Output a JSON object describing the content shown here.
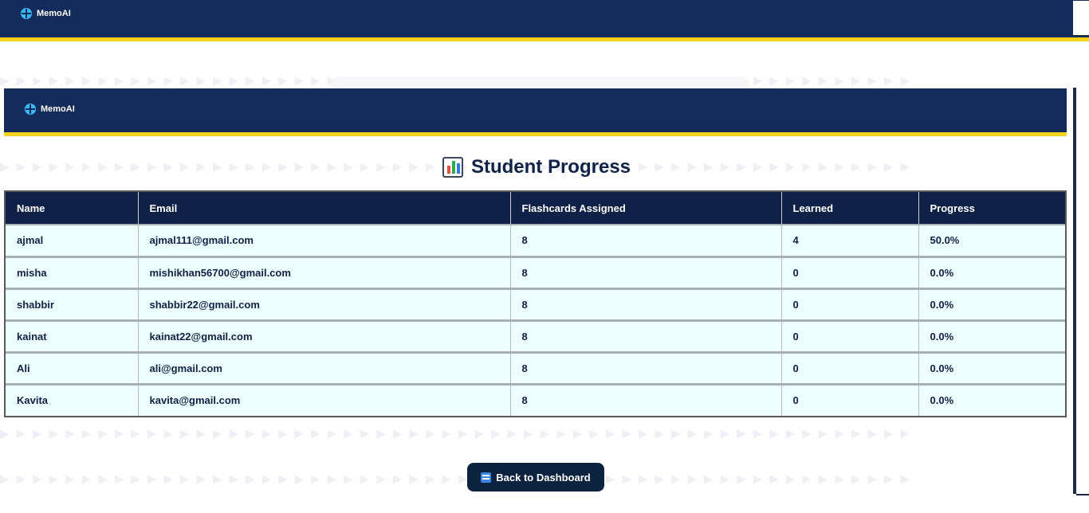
{
  "app": {
    "brand": "MemoAI"
  },
  "page": {
    "title": "Student Progress",
    "title_icon": "bar-chart-icon"
  },
  "table": {
    "columns": [
      "Name",
      "Email",
      "Flashcards Assigned",
      "Learned",
      "Progress"
    ],
    "rows": [
      {
        "name": "ajmal",
        "email": "ajmal111@gmail.com",
        "assigned": "8",
        "learned": "4",
        "progress": "50.0%"
      },
      {
        "name": "misha",
        "email": "mishikhan56700@gmail.com",
        "assigned": "8",
        "learned": "0",
        "progress": "0.0%"
      },
      {
        "name": "shabbir",
        "email": "shabbir22@gmail.com",
        "assigned": "8",
        "learned": "0",
        "progress": "0.0%"
      },
      {
        "name": "kainat",
        "email": "kainat22@gmail.com",
        "assigned": "8",
        "learned": "0",
        "progress": "0.0%"
      },
      {
        "name": "Ali",
        "email": "ali@gmail.com",
        "assigned": "8",
        "learned": "0",
        "progress": "0.0%"
      },
      {
        "name": "Kavita",
        "email": "kavita@gmail.com",
        "assigned": "8",
        "learned": "0",
        "progress": "0.0%"
      }
    ]
  },
  "actions": {
    "back_label": "Back to Dashboard",
    "back_icon": "back-icon"
  },
  "colors": {
    "navbar": "#142c5c",
    "accent": "#f7d21b",
    "table_header": "#0f2147",
    "row_bg": "#effefe",
    "button": "#0c2340"
  }
}
